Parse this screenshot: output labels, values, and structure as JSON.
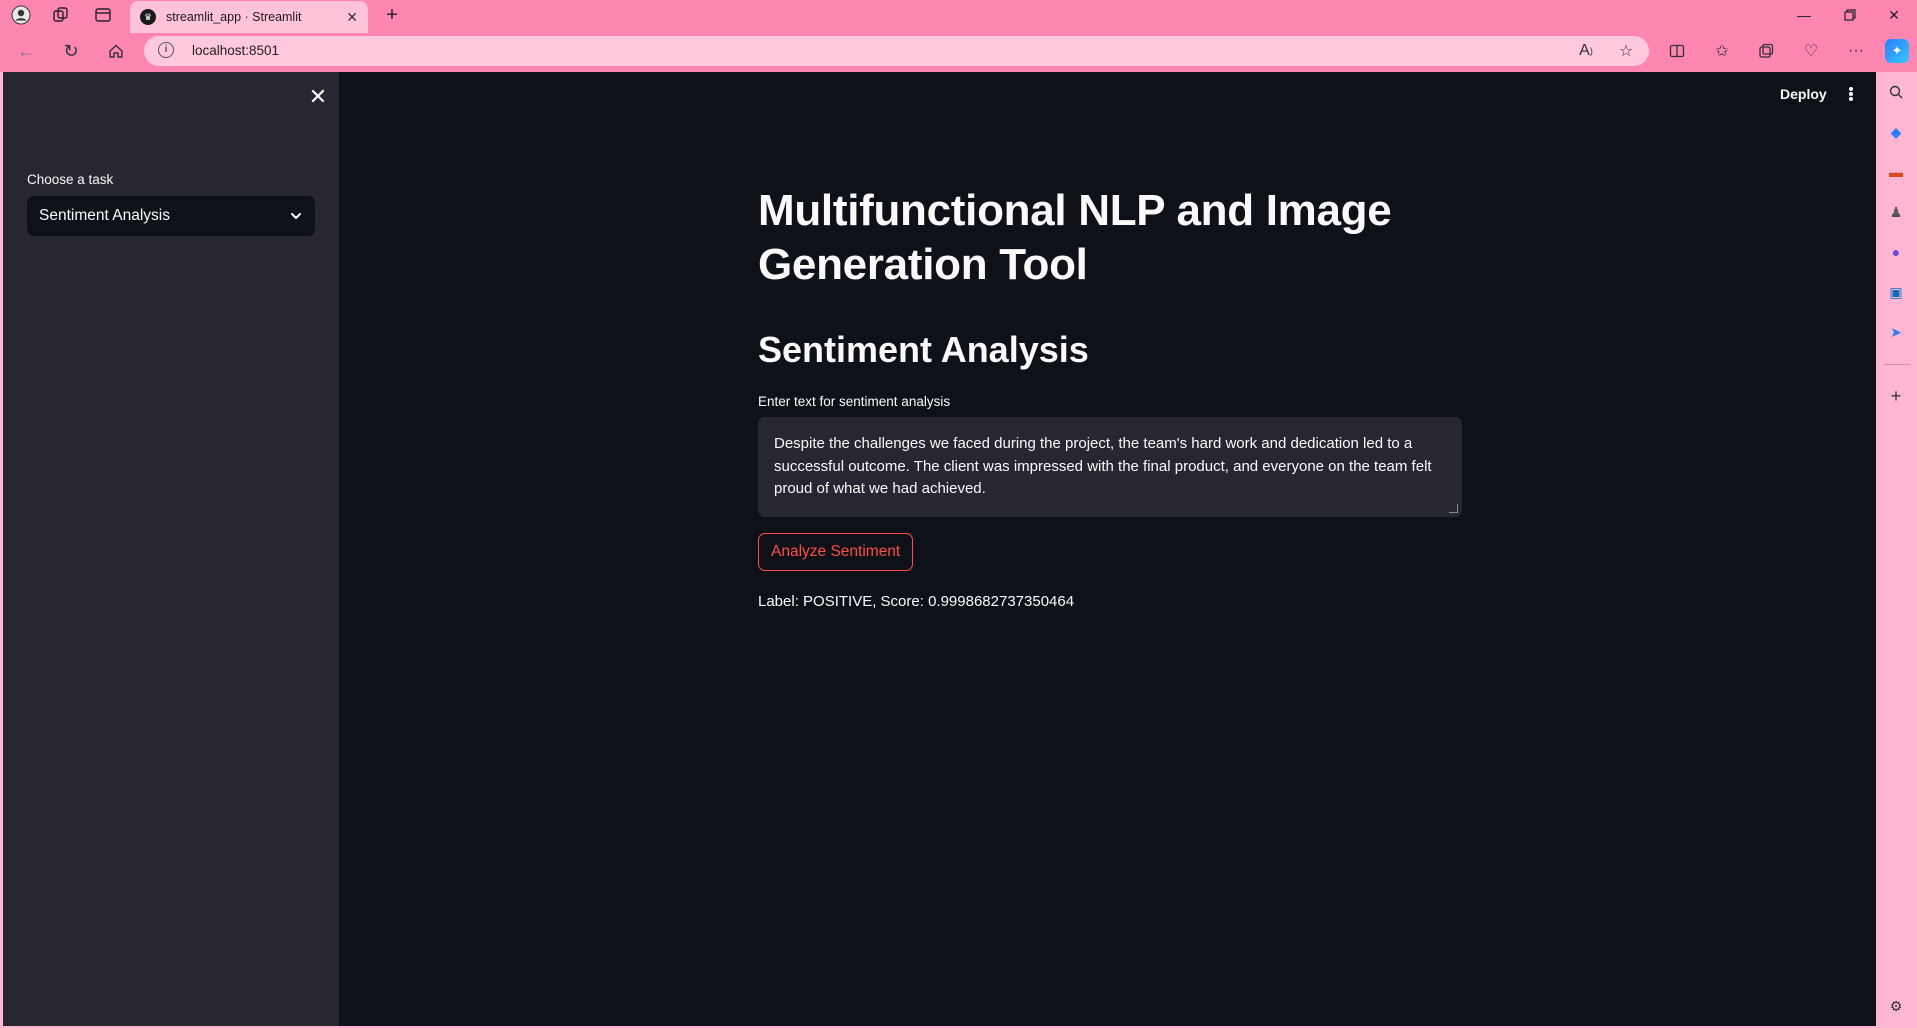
{
  "browser": {
    "tab_title": "streamlit_app · Streamlit",
    "url": "localhost:8501"
  },
  "sidebar": {
    "task_label": "Choose a task",
    "task_selected": "Sentiment Analysis"
  },
  "header": {
    "deploy_label": "Deploy"
  },
  "main": {
    "title": "Multifunctional NLP and Image Generation Tool",
    "section_title": "Sentiment Analysis",
    "input_label": "Enter text for sentiment analysis",
    "input_value": "Despite the challenges we faced during the project, the team's hard work and dedication led to a successful outcome. The client was impressed with the final product, and everyone on the team felt proud of what we had achieved.",
    "button_label": "Analyze Sentiment",
    "result_text": "Label: POSITIVE, Score: 0.9998682737350464"
  },
  "colors": {
    "app_bg": "#0e1117",
    "sidebar_bg": "#262730",
    "accent": "#ff4b4b",
    "browser_chrome": "#ff86b1"
  }
}
